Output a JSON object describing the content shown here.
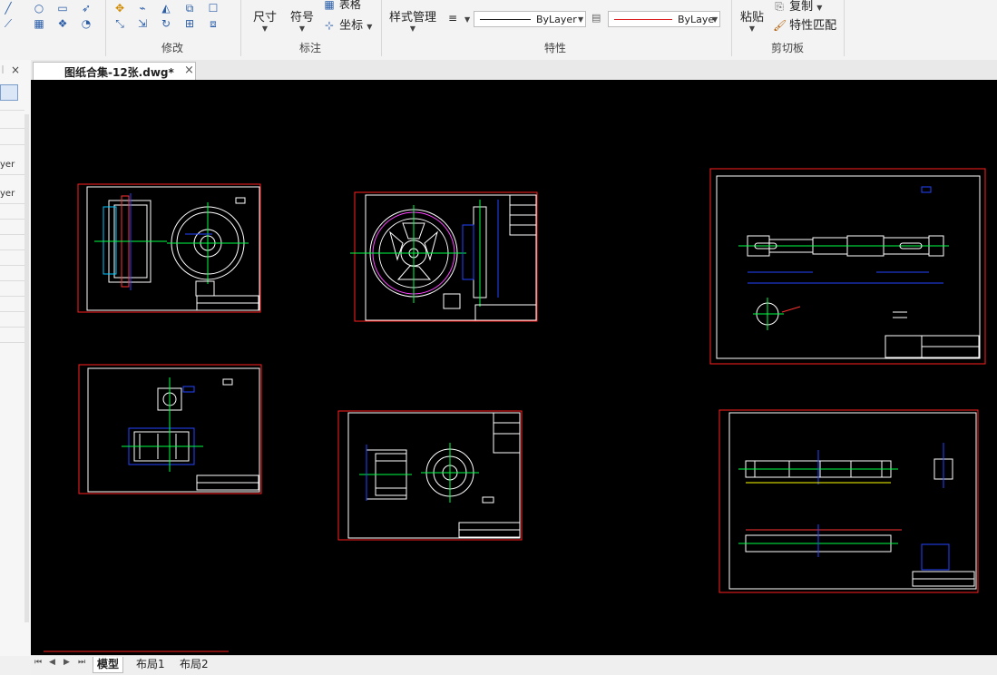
{
  "ribbon": {
    "groups": {
      "modify": "修改",
      "annotation": "标注",
      "properties": "特性",
      "clipboard": "剪切板"
    },
    "buttons": {
      "dimension": "尺寸",
      "symbol": "符号",
      "table": "表格",
      "coordinate": "坐标",
      "style_manager": "样式管理",
      "paste": "粘贴",
      "copy": "复制",
      "match_properties": "特性匹配"
    },
    "properties": {
      "linetype": "ByLayer",
      "color": "ByLaye"
    }
  },
  "left_panel": {
    "items": [
      "yer",
      "yer"
    ]
  },
  "document_tab": {
    "title": "图纸合集-12张.dwg*",
    "close": "×"
  },
  "layout_tabs": [
    "模型",
    "布局1",
    "布局2"
  ],
  "nav_arrows": [
    "⏮",
    "◀",
    "▶",
    "⏭"
  ],
  "colors": {
    "canvas": "#000000",
    "frame_red": "#ff2020",
    "ribbon_bg": "#f3f3f3"
  }
}
